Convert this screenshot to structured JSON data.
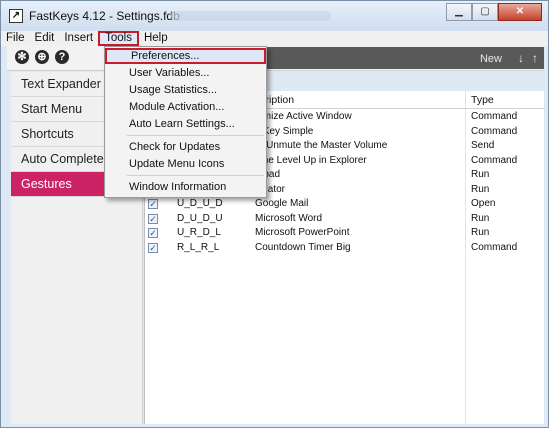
{
  "window": {
    "title": "FastKeys 4.12 - Settings.fdb",
    "app_icon": "arrow-icon"
  },
  "menubar": {
    "items": [
      "File",
      "Edit",
      "Insert",
      "Tools",
      "Help"
    ]
  },
  "toolbar": {
    "icons": [
      "gear-icon",
      "globe-icon",
      "help-icon"
    ],
    "new_label": "New",
    "down_arrow": "↓",
    "up_arrow": "↑"
  },
  "sidebar": {
    "items": [
      "Text Expander",
      "Start Menu",
      "Shortcuts",
      "Auto Complete",
      "Gestures"
    ],
    "active": "Gestures",
    "accent": "#cc2366"
  },
  "tools_menu": {
    "items": [
      "Preferences...",
      "User Variables...",
      "Usage Statistics...",
      "Module Activation...",
      "Auto Learn Settings...",
      "Check for Updates",
      "Update Menu Icons",
      "Window Information"
    ],
    "highlighted": "Preferences..."
  },
  "table": {
    "headers": {
      "description": "scription",
      "type": "Type"
    },
    "rows": [
      {
        "checked": true,
        "gesture": "",
        "description": "nimize Active Window",
        "type": "Command"
      },
      {
        "checked": true,
        "gesture": "",
        "description": "s Key Simple",
        "type": "Command"
      },
      {
        "checked": true,
        "gesture": "",
        "description": "te/Unmute the Master Volume",
        "type": "Send"
      },
      {
        "checked": true,
        "gesture": "",
        "description": "One Level Up in Explorer",
        "type": "Command"
      },
      {
        "checked": true,
        "gesture": "",
        "description": "tepad",
        "type": "Run"
      },
      {
        "checked": true,
        "gesture": "",
        "description": "culator",
        "type": "Run"
      },
      {
        "checked": true,
        "gesture": "U_D_U_D",
        "description": "Google Mail",
        "type": "Open"
      },
      {
        "checked": true,
        "gesture": "D_U_D_U",
        "description": "Microsoft Word",
        "type": "Run"
      },
      {
        "checked": true,
        "gesture": "U_R_D_L",
        "description": "Microsoft PowerPoint",
        "type": "Run"
      },
      {
        "checked": true,
        "gesture": "R_L_R_L",
        "description": "Countdown Timer Big",
        "type": "Command"
      }
    ]
  },
  "colors": {
    "highlight_border": "#cc1a2a",
    "title_bar": "#dfe9f5"
  }
}
